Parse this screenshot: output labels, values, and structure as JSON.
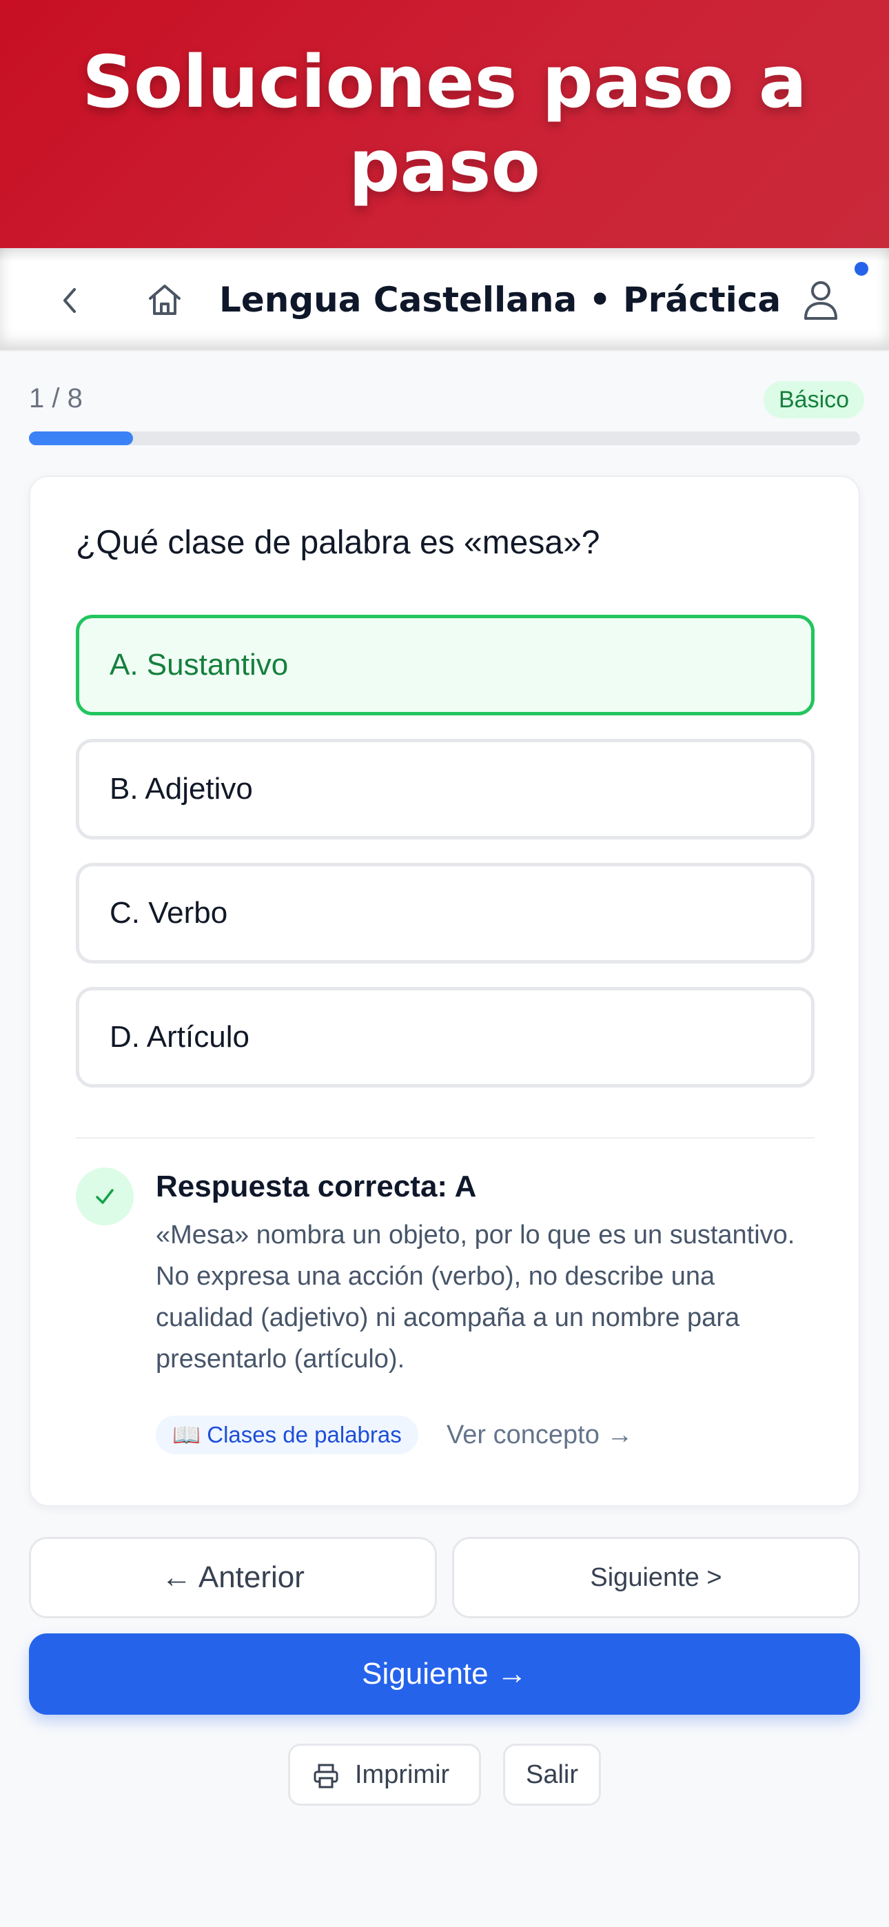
{
  "banner": {
    "title": "Soluciones paso a paso"
  },
  "navbar": {
    "title": "Lengua Castellana • Práctica"
  },
  "progress": {
    "label": "1 / 8",
    "fraction": 0.125,
    "level": "Básico"
  },
  "question": {
    "text": "¿Qué clase de palabra es «mesa»?",
    "options": [
      {
        "label": "A. Sustantivo",
        "state": "correct"
      },
      {
        "label": "B. Adjetivo",
        "state": "default"
      },
      {
        "label": "C. Verbo",
        "state": "default"
      },
      {
        "label": "D. Artículo",
        "state": "default"
      }
    ]
  },
  "solution": {
    "title": "Respuesta correcta: A",
    "explanation": "«Mesa» nombra un objeto, por lo que es un sustantivo. No expresa una acción (verbo), no describe una cualidad (adjetivo) ni acompaña a un nombre para presentarlo (artículo).",
    "concept_tag": "📖 Clases de palabras",
    "concept_link": "Ver concepto →"
  },
  "actions": {
    "prev": "← Anterior",
    "next_outline": "Siguiente >",
    "next_primary": "Siguiente →",
    "print": "Imprimir",
    "exit": "Salir"
  },
  "colors": {
    "accent": "#2563eb",
    "success": "#22c55e",
    "banner": "#c80f23"
  }
}
